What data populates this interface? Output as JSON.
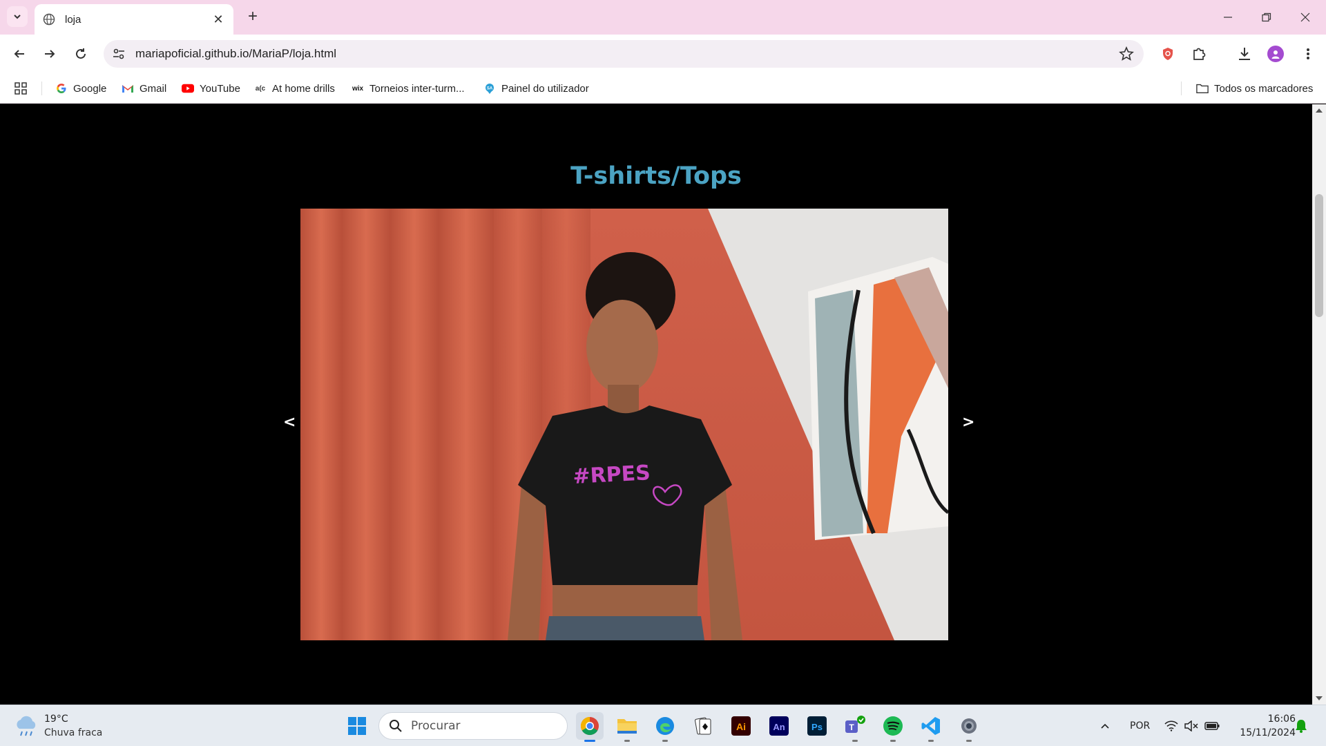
{
  "browser": {
    "tab_title": "loja",
    "url": "mariapoficial.github.io/MariaP/loja.html",
    "profile_color": "#a44bd0",
    "tab_strip_color": "#f6d7ea"
  },
  "bookmarks": {
    "items": [
      {
        "label": "Google",
        "icon": "google-icon"
      },
      {
        "label": "Gmail",
        "icon": "gmail-icon"
      },
      {
        "label": "YouTube",
        "icon": "youtube-icon"
      },
      {
        "label": "At home drills",
        "icon": "athome-icon"
      },
      {
        "label": "Torneios inter-turm...",
        "icon": "wix-icon"
      },
      {
        "label": "Painel do utilizador",
        "icon": "panel-icon"
      }
    ],
    "all_bookmarks": "Todos os marcadores"
  },
  "page": {
    "title": "T-shirts/Tops",
    "title_color": "#4ba3c3",
    "prev_label": "<",
    "next_label": ">",
    "slide": {
      "shirt_text": "#RPES"
    }
  },
  "taskbar": {
    "weather_temp": "19°C",
    "weather_condition": "Chuva fraca",
    "search_placeholder": "Procurar",
    "language": "POR",
    "time": "16:06",
    "date": "15/11/2024"
  }
}
